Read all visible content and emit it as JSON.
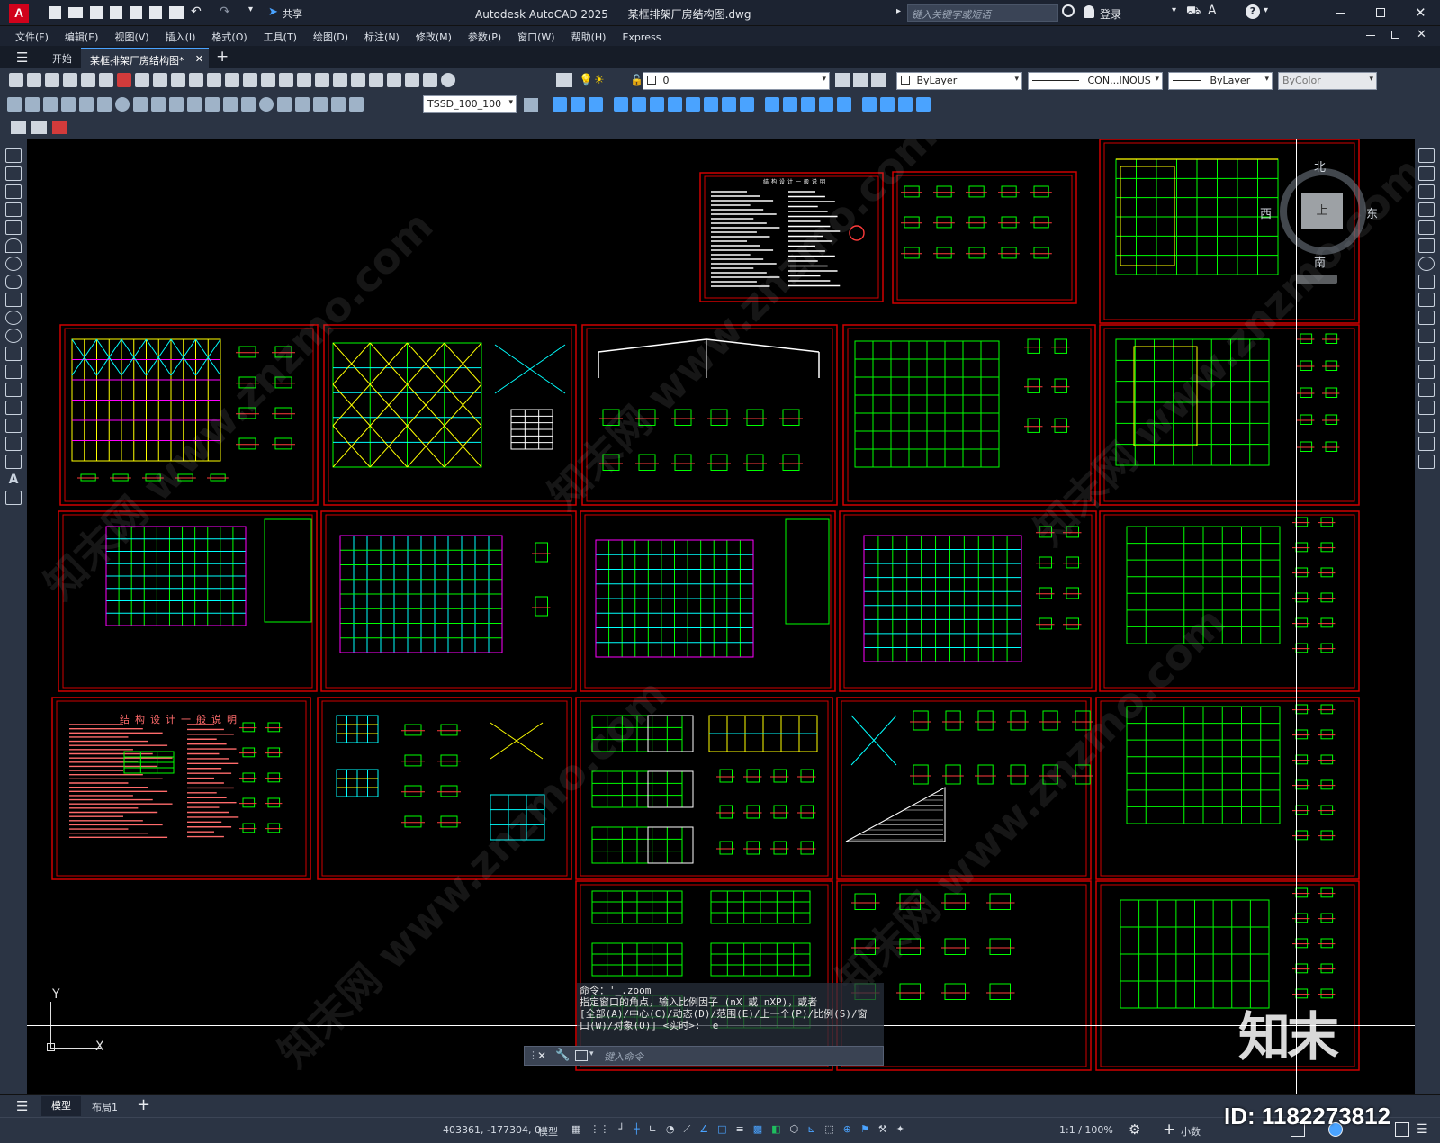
{
  "window": {
    "app_name": "Autodesk AutoCAD 2025",
    "file_name": "某框排架厂房结构图.dwg",
    "share_label": "共享",
    "search_placeholder": "键入关键字或短语",
    "login_label": "登录"
  },
  "menu": [
    "文件(F)",
    "编辑(E)",
    "视图(V)",
    "插入(I)",
    "格式(O)",
    "工具(T)",
    "绘图(D)",
    "标注(N)",
    "修改(M)",
    "参数(P)",
    "窗口(W)",
    "帮助(H)",
    "Express"
  ],
  "doc_tabs": {
    "start": "开始",
    "active": "某框排架厂房结构图*"
  },
  "toolbar": {
    "layer_value": "0",
    "color": "ByLayer",
    "linetype": "CON...INOUS",
    "lineweight": "ByLayer",
    "plotstyle": "ByColor",
    "dimstyle": "TSSD_100_100"
  },
  "viewcube": {
    "north": "北",
    "south": "南",
    "east": "东",
    "west": "西",
    "top": "上"
  },
  "ucs": {
    "x": "X",
    "y": "Y"
  },
  "command": {
    "line1": "命令：'_.zoom",
    "line2": "指定窗口的角点，输入比例因子 (nX 或 nXP)，或者",
    "line3": "[全部(A)/中心(C)/动态(D)/范围(E)/上一个(P)/比例(S)/窗",
    "line4": "口(W)/对象(O)] <实时>: _e",
    "input_placeholder": "键入命令"
  },
  "sheets": {
    "general_notes_title": "结构设计一般说明",
    "small_notes_title": "结构设计一般说明"
  },
  "layout_tabs": {
    "model": "模型",
    "layout1": "布局1"
  },
  "status": {
    "coords": "403361, -177304, 0",
    "model": "模型",
    "scale": "1:1 / 100%",
    "units": "小数"
  },
  "overlay": {
    "id_text": "ID: 1182273812",
    "logo_text": "知末",
    "watermark_text": "知末网 www.znzmo.com"
  },
  "colors": {
    "title_bg": "#1c2331",
    "canvas_bg": "#000000",
    "frame_red": "#d00000",
    "line_green": "#00ff00",
    "line_cyan": "#00ffff",
    "line_yellow": "#ffff00",
    "line_magenta": "#ff00ff"
  }
}
